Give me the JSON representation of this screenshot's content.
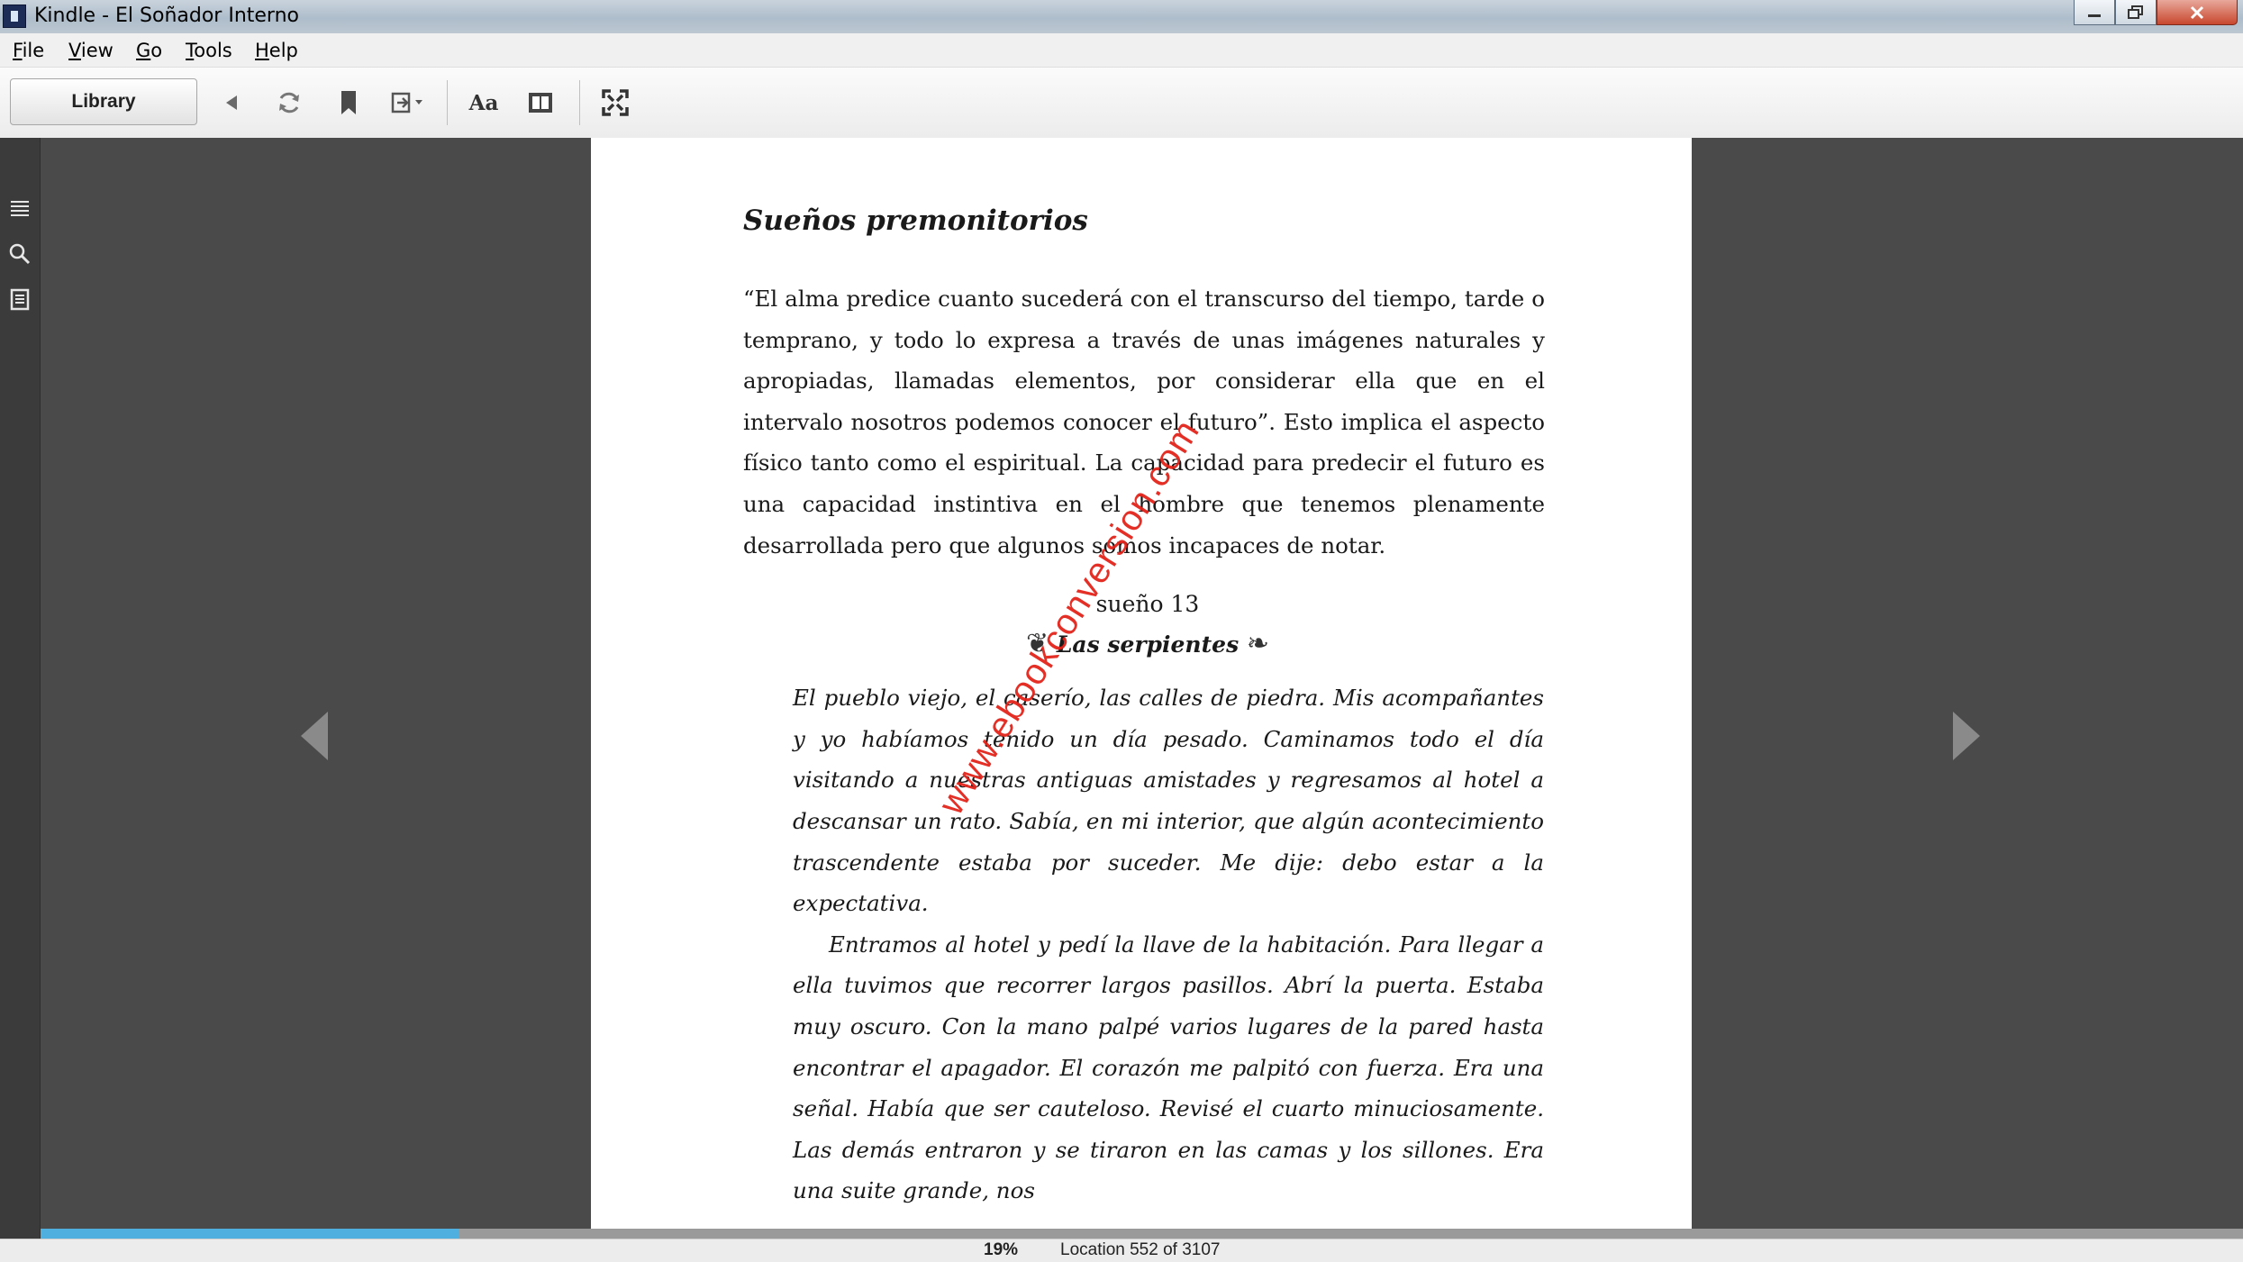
{
  "window": {
    "title": "Kindle - El Soñador Interno"
  },
  "menu": [
    "File",
    "View",
    "Go",
    "Tools",
    "Help"
  ],
  "toolbar": {
    "library_label": "Library",
    "icons": [
      "back-arrow-icon",
      "sync-icon",
      "bookmark-icon",
      "goto-icon",
      "font-size-icon",
      "columns-icon",
      "fullscreen-icon"
    ],
    "font_label": "Aa"
  },
  "sidebar": {
    "icons": [
      "table-of-contents-icon",
      "search-icon",
      "notes-icon"
    ]
  },
  "page": {
    "chapter_title": "Sueños premonitorios",
    "intro": "“El alma predice cuanto sucederá con el transcurso del tiempo, tarde o temprano, y todo lo expresa a través de unas imágenes naturales y apropiadas, llamadas elementos, por considerar ella que en el intervalo nosotros podemos conocer el futuro”. Esto implica el aspecto físico tanto como el espiritual. La capacidad para predecir el futuro es una capacidad instintiva en el hombre que tenemos plenamente desarrollada pero que algunos somos incapaces de notar.",
    "dream_number": "sueño 13",
    "dream_title": "Las serpientes",
    "dream_p1": "El pueblo viejo, el caserío, las calles de piedra. Mis acompañantes y yo habíamos tenido un día pesado. Caminamos todo el día visitando a nuestras antiguas amistades y regresamos al hotel a descansar un rato. Sabía, en mi interior, que algún acontecimiento trascendente estaba por suceder. Me dije: debo estar a la expectativa.",
    "dream_p2": "Entramos al hotel y pedí la llave de la habitación. Para llegar a ella tuvimos que recorrer largos pasillos. Abrí la puerta. Estaba muy oscuro. Con la mano palpé varios lugares de la pared hasta encontrar el apagador. El corazón me palpitó con fuerza. Era una señal. Había que ser cauteloso. Revisé el cuarto minuciosamente. Las demás entraron y se tiraron en las camas y los sillones. Era una suite grande, nos",
    "watermark": "www.ebookconversion.com"
  },
  "status": {
    "percent_label": "19%",
    "progress": 0.19,
    "location": "Location 552 of 3107"
  },
  "colors": {
    "progress": "#4fb0e0",
    "watermark": "#e3241b",
    "page": "#ffffff",
    "background": "#4a4a4a"
  }
}
